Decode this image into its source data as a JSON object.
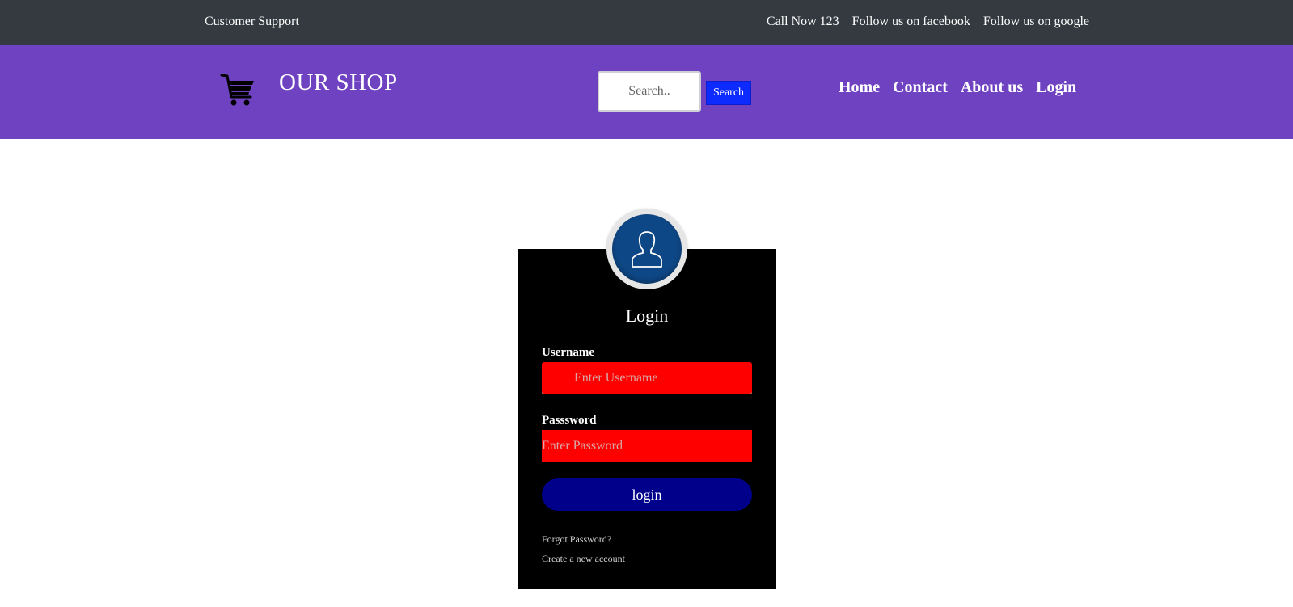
{
  "topbar": {
    "support": "Customer Support",
    "call": "Call Now 123",
    "facebook": "Follow us on facebook",
    "google": "Follow us on google"
  },
  "header": {
    "brand": "OUR SHOP",
    "search_placeholder": "Search..",
    "search_button": "Search",
    "nav": {
      "home": "Home",
      "contact": "Contact",
      "about": "About us",
      "login": "Login"
    },
    "icons": [
      "shopping-cart-icon"
    ]
  },
  "login_card": {
    "title": "Login",
    "username_label": "Username",
    "username_placeholder": "Enter Username",
    "password_label": "Passsword",
    "password_placeholder": "Enter Password",
    "submit": "login",
    "forgot": "Forgot Password?",
    "create": "Create a new account",
    "icons": [
      "user-avatar-icon"
    ]
  },
  "colors": {
    "topbar": "#343a40",
    "header": "#6f42c1",
    "search_button": "#0d2bff",
    "card": "#000000",
    "avatar": "#0e4785",
    "input": "#ff0000",
    "login_button": "#00008b"
  }
}
